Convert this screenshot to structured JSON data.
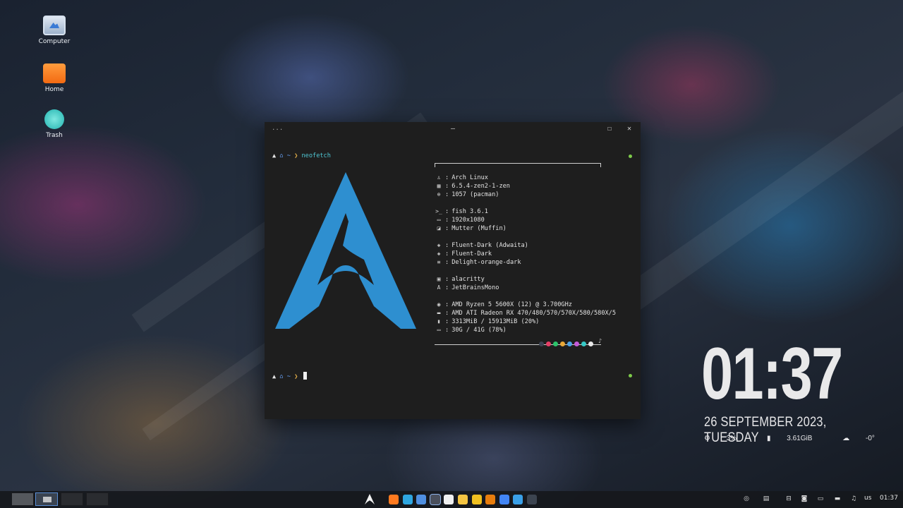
{
  "desktop": {
    "icons": [
      {
        "label": "Computer"
      },
      {
        "label": "Home"
      },
      {
        "label": "Trash"
      }
    ]
  },
  "terminal": {
    "title_dots": "...",
    "controls": {
      "minimize": "–",
      "maximize": "☐",
      "close": "✕"
    },
    "prompt_symbol": "~",
    "prompt_sep": "❯",
    "command": "neofetch",
    "info": [
      {
        "icon": "arch-icon",
        "glyph": "♙",
        "value": "Arch Linux"
      },
      {
        "icon": "kernel-icon",
        "glyph": "▦",
        "value": "6.5.4-zen2-1-zen"
      },
      {
        "icon": "packages-icon",
        "glyph": "⊕",
        "value": "1057 (pacman)"
      },
      {
        "icon": "shell-icon",
        "glyph": ">_",
        "value": "fish 3.6.1"
      },
      {
        "icon": "display-icon",
        "glyph": "▭",
        "value": "1920x1080"
      },
      {
        "icon": "wm-icon",
        "glyph": "◪",
        "value": "Mutter (Muffin)"
      },
      {
        "icon": "theme-icon",
        "glyph": "◈",
        "value": "Fluent-Dark (Adwaita)"
      },
      {
        "icon": "icons-icon",
        "glyph": "◈",
        "value": "Fluent-Dark"
      },
      {
        "icon": "cursor-theme-icon",
        "glyph": "≡",
        "value": "Delight-orange-dark"
      },
      {
        "icon": "terminal-icon",
        "glyph": "▣",
        "value": "alacritty"
      },
      {
        "icon": "font-icon",
        "glyph": "A",
        "value": "JetBrainsMono"
      },
      {
        "icon": "cpu-icon",
        "glyph": "◉",
        "value": "AMD Ryzen 5 5600X (12) @ 3.700GHz"
      },
      {
        "icon": "gpu-icon",
        "glyph": "▬",
        "value": "AMD ATI Radeon RX 470/480/570/570X/580/580X/5"
      },
      {
        "icon": "memory-icon",
        "glyph": "▮",
        "value": "3313MiB / 15913MiB (20%)"
      },
      {
        "icon": "disk-icon",
        "glyph": "▭",
        "value": "30G / 41G (78%)"
      }
    ],
    "colon": ":",
    "palette": [
      "#3b4252",
      "#e53e66",
      "#2cc36b",
      "#e8a838",
      "#4aa3e8",
      "#c45ad8",
      "#36c9c6",
      "#e8e8e8"
    ],
    "note_glyph": "♪"
  },
  "clock": {
    "time": "01:37",
    "date": "26 SEPTEMBER 2023, TUESDAY",
    "cpu": "3%",
    "ram": "3.61GiB",
    "temp": "-0°"
  },
  "taskbar": {
    "keyboard_layout": "us",
    "time": "01:37",
    "apps": [
      {
        "name": "firefox-icon",
        "color": "#ff7a1f"
      },
      {
        "name": "telegram-icon",
        "color": "#2ea6e0"
      },
      {
        "name": "files-icon",
        "color": "#4f8fe0"
      },
      {
        "name": "terminal-app-icon",
        "color": "#4a4f5c"
      },
      {
        "name": "notion-icon",
        "color": "#f0f0f0"
      },
      {
        "name": "notes-icon",
        "color": "#f5c542"
      },
      {
        "name": "emoji-icon",
        "color": "#f0c020"
      },
      {
        "name": "blender-icon",
        "color": "#e87d0d"
      },
      {
        "name": "chrome-icon",
        "color": "#4285f4"
      },
      {
        "name": "video-player-icon",
        "color": "#3aa0e8"
      },
      {
        "name": "steam-icon",
        "color": "#3c4450"
      }
    ]
  }
}
